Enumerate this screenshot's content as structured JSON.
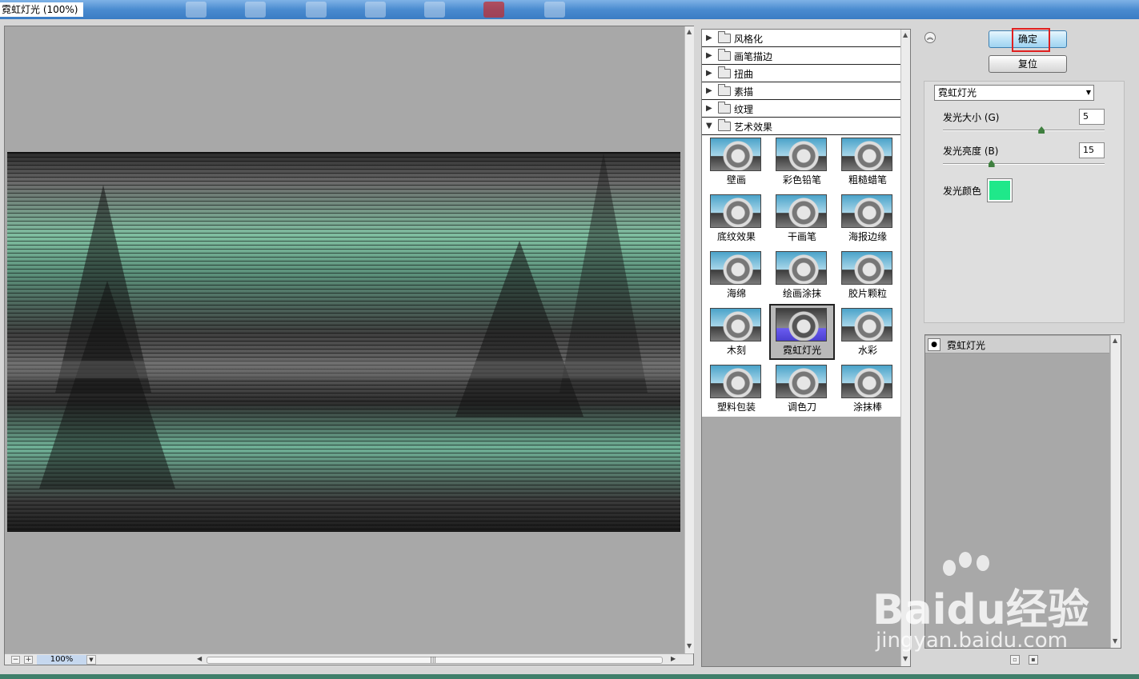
{
  "window": {
    "title": "霓虹灯光 (100%)"
  },
  "preview": {
    "zoom": "100%",
    "minus": "−",
    "plus": "+"
  },
  "filter_categories": [
    {
      "label": "风格化",
      "expanded": false
    },
    {
      "label": "画笔描边",
      "expanded": false
    },
    {
      "label": "扭曲",
      "expanded": false
    },
    {
      "label": "素描",
      "expanded": false
    },
    {
      "label": "纹理",
      "expanded": false
    },
    {
      "label": "艺术效果",
      "expanded": true
    }
  ],
  "artistic_filters": [
    "壁画",
    "彩色铅笔",
    "粗糙蜡笔",
    "底纹效果",
    "干画笔",
    "海报边缘",
    "海绵",
    "绘画涂抹",
    "胶片颗粒",
    "木刻",
    "霓虹灯光",
    "水彩",
    "塑料包装",
    "调色刀",
    "涂抹棒"
  ],
  "selected_filter": "霓虹灯光",
  "buttons": {
    "ok": "确定",
    "reset": "复位"
  },
  "filter_select": {
    "value": "霓虹灯光"
  },
  "params": {
    "glow_size": {
      "label": "发光大小 (G)",
      "value": "5",
      "fraction": 0.61
    },
    "glow_brightness": {
      "label": "发光亮度 (B)",
      "value": "15",
      "fraction": 0.3
    },
    "glow_color": {
      "label": "发光颜色",
      "color": "#1fe88a"
    }
  },
  "layers": [
    {
      "name": "霓虹灯光",
      "visible": true
    }
  ],
  "watermark": {
    "main": "Baidu经验",
    "url": "jingyan.baidu.com"
  },
  "colors": {
    "accent_ok": "#9fd3f1",
    "highlight": "#e02020"
  }
}
